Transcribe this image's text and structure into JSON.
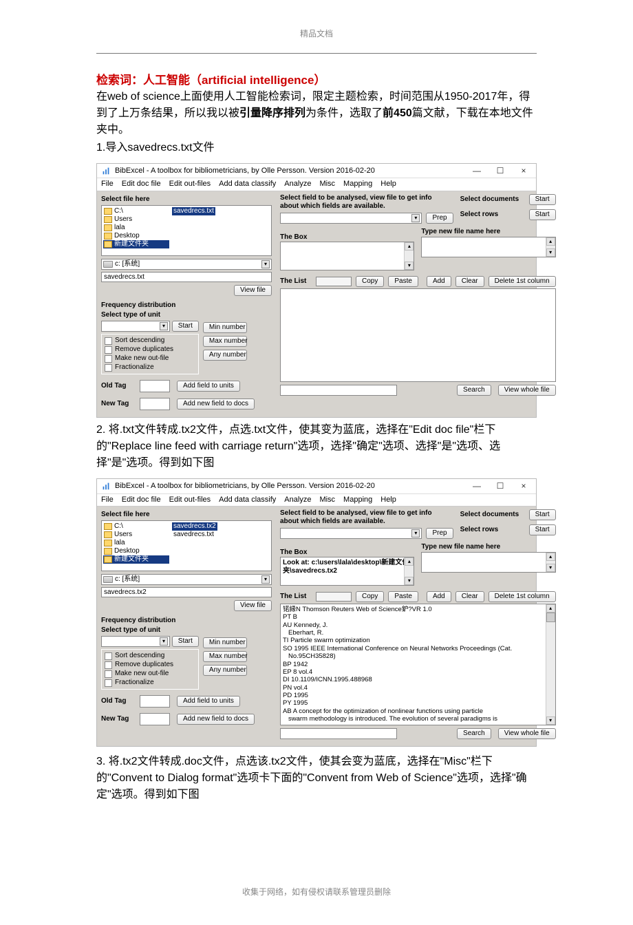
{
  "page_header": "精品文档",
  "page_footer": "收集于网络，如有侵权请联系管理员删除",
  "title_line": "检索词：人工智能（artificial intelligence）",
  "intro_prefix": "在web of science上面使用人工智能检索词，限定主题检索，时间范围从1950-2017年，得到了上万条结果，所以我以被",
  "intro_bold1": "引量降序排列",
  "intro_mid": "为条件，选取了",
  "intro_bold2": "前450",
  "intro_suffix": "篇文献，下载在本地文件夹中。",
  "step1": "1.导入savedrecs.txt文件",
  "step2": "2. 将.txt文件转成.tx2文件，点选.txt文件，使其变为蓝底，选择在\"Edit doc file\"栏下的\"Replace line feed with carriage return\"选项，选择\"确定\"选项、选择\"是\"选项、选择\"是\"选项。得到如下图",
  "step3": "3. 将.tx2文件转成.doc文件，点选该.tx2文件，使其会变为蓝底，选择在\"Misc\"栏下的\"Convent to Dialog format\"选项卡下面的\"Convent from Web of Science\"选项，选择\"确定\"选项。得到如下图",
  "app": {
    "title": "BibExcel - A toolbox for bibliometricians, by Olle Persson. Version 2016-02-20",
    "menubar": [
      "File",
      "Edit doc file",
      "Edit out-files",
      "Add data classify",
      "Analyze",
      "Misc",
      "Mapping",
      "Help"
    ],
    "win": {
      "min": "—",
      "max": "☐",
      "close": "×"
    },
    "left": {
      "select_file": "Select file here",
      "tree": [
        "C:\\",
        "Users",
        "lala",
        "Desktop",
        "新建文件夹"
      ],
      "drive": "c: [系统]",
      "path1": "savedrecs.txt",
      "path2": "savedrecs.tx2",
      "file_sel1": "savedrecs.txt",
      "file_sel2a": "savedrecs.tx2",
      "file_sel2b": "savedrecs.txt",
      "view_file": "View file",
      "freq_title": "Frequency distribution",
      "select_type": "Select type of unit",
      "start": "Start",
      "btns": [
        "Min number",
        "Max number",
        "Any number"
      ],
      "checks": [
        "Sort descending",
        "Remove duplicates",
        "Make new out-file",
        "Fractionalize"
      ],
      "old_tag": "Old Tag",
      "new_tag": "New Tag",
      "add_units": "Add field to units",
      "add_new_docs": "Add new field to docs"
    },
    "right": {
      "msg": "Select field to be analysed, view file to get info about which fields are available.",
      "prep": "Prep",
      "sel_docs": "Select documents",
      "sel_rows": "Select rows",
      "start": "Start",
      "the_box": "The Box",
      "box_content": "Look at: c:\\users\\lala\\desktop\\新建文件夹\\savedrecs.tx2",
      "type_new": "Type new file name here",
      "the_list": "The List",
      "copy": "Copy",
      "paste": "Paste",
      "add": "Add",
      "clear": "Clear",
      "del_col": "Delete 1st column",
      "search": "Search",
      "view_whole": "View whole file",
      "list_content": [
        "锘縁N Thomson Reuters Web of Science鈩?VR 1.0",
        "PT B",
        "AU Kennedy, J.",
        "   Eberhart, R.",
        "TI Particle swarm optimization",
        "SO 1995 IEEE International Conference on Neural Networks Proceedings (Cat.",
        "   No.95CH35828)",
        "BP 1942",
        "EP 8 vol.4",
        "DI 10.1109/ICNN.1995.488968",
        "PN vol.4",
        "PD 1995",
        "PY 1995",
        "AB A concept for the optimization of nonlinear functions using particle",
        "   swarm methodology is introduced. The evolution of several paradigms is"
      ]
    }
  }
}
